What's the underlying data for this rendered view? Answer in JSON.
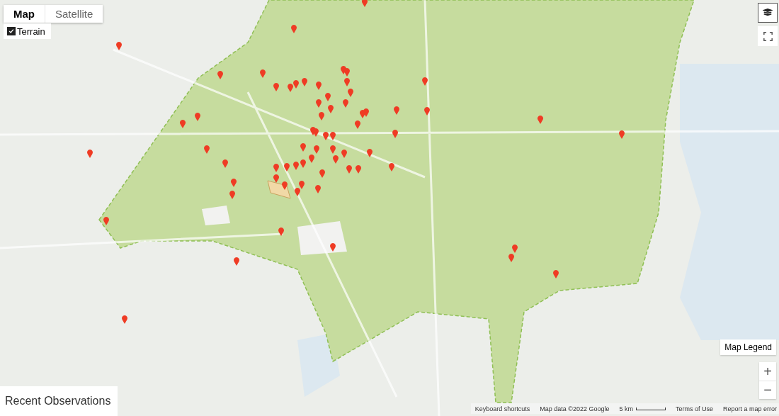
{
  "map_types": [
    {
      "label": "Map",
      "selected": true
    },
    {
      "label": "Satellite",
      "selected": false
    }
  ],
  "terrain": {
    "label": "Terrain",
    "checked": true
  },
  "map_legend": {
    "label": "Map Legend"
  },
  "zoom": {
    "in": "+",
    "out": "−"
  },
  "panel": {
    "title": "Recent Observations"
  },
  "footer": {
    "shortcuts": "Keyboard shortcuts",
    "map_data": "Map data ©2022 Google",
    "scale": "5 km",
    "terms": "Terms of Use",
    "report": "Report a map error"
  }
}
